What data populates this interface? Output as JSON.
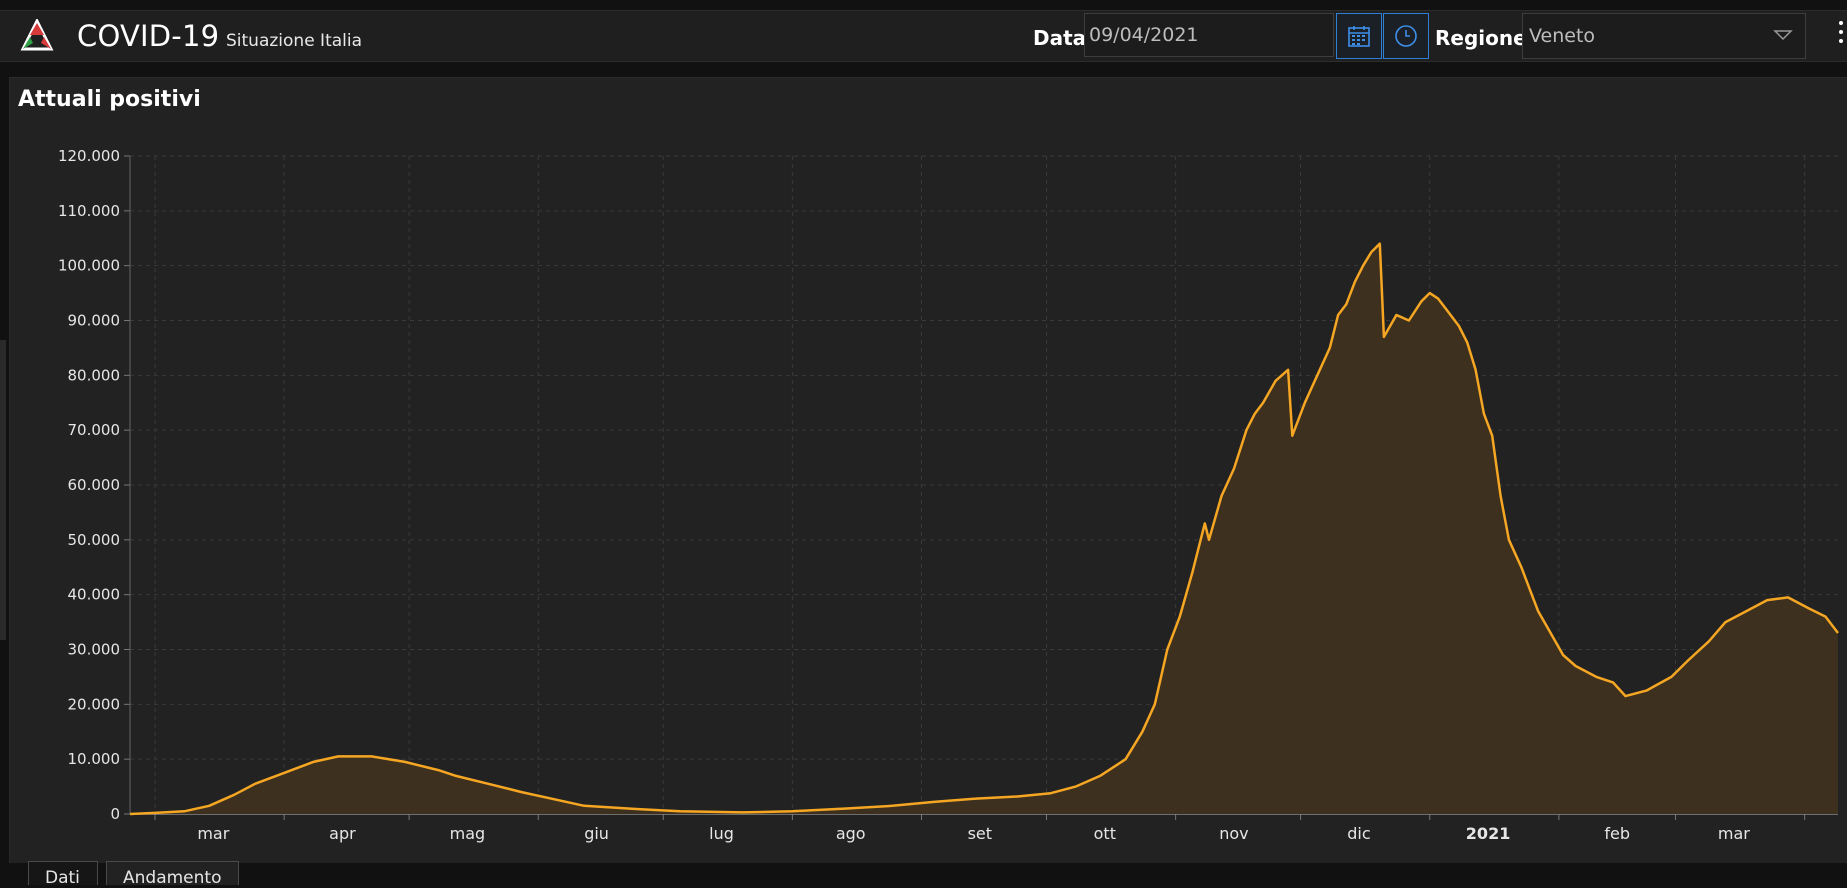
{
  "header": {
    "app_title": "COVID-19",
    "app_subtitle": "Situazione Italia",
    "date_label": "Data",
    "date_value": "09/04/2021",
    "region_label": "Regione",
    "region_value": "Veneto",
    "icons": {
      "logo": "protezione-civile-logo",
      "calendar": "calendar-icon",
      "clock": "clock-icon",
      "dropdown": "chevron-down-icon",
      "menu": "vertical-dots-icon"
    },
    "accent_color": "#2f7fd6"
  },
  "panel": {
    "title": "Attuali positivi"
  },
  "tabs": [
    {
      "label": "Dati"
    },
    {
      "label": "Andamento"
    }
  ],
  "chart_data": {
    "type": "area",
    "title": "Attuali positivi",
    "xlabel": "",
    "ylabel": "",
    "ylim": [
      0,
      120000
    ],
    "xlim": [
      "2020-02-24",
      "2021-04-09"
    ],
    "yticks": [
      0,
      10000,
      20000,
      30000,
      40000,
      50000,
      60000,
      70000,
      80000,
      90000,
      100000,
      110000,
      120000
    ],
    "ytick_labels": [
      "0",
      "10.000",
      "20.000",
      "30.000",
      "40.000",
      "50.000",
      "60.000",
      "70.000",
      "80.000",
      "90.000",
      "100.000",
      "110.000",
      "120.000"
    ],
    "xticks": [
      {
        "date": "2020-03-15",
        "label": "mar",
        "bold": false
      },
      {
        "date": "2020-04-15",
        "label": "apr",
        "bold": false
      },
      {
        "date": "2020-05-15",
        "label": "mag",
        "bold": false
      },
      {
        "date": "2020-06-15",
        "label": "giu",
        "bold": false
      },
      {
        "date": "2020-07-15",
        "label": "lug",
        "bold": false
      },
      {
        "date": "2020-08-15",
        "label": "ago",
        "bold": false
      },
      {
        "date": "2020-09-15",
        "label": "set",
        "bold": false
      },
      {
        "date": "2020-10-15",
        "label": "ott",
        "bold": false
      },
      {
        "date": "2020-11-15",
        "label": "nov",
        "bold": false
      },
      {
        "date": "2020-12-15",
        "label": "dic",
        "bold": false
      },
      {
        "date": "2021-01-15",
        "label": "2021",
        "bold": true
      },
      {
        "date": "2021-02-15",
        "label": "feb",
        "bold": false
      },
      {
        "date": "2021-03-15",
        "label": "mar",
        "bold": false
      }
    ],
    "grid": true,
    "line_color": "#f5a623",
    "fill_color": "#3d301e",
    "series": [
      {
        "name": "",
        "points": [
          [
            "2020-02-24",
            0
          ],
          [
            "2020-03-01",
            200
          ],
          [
            "2020-03-08",
            500
          ],
          [
            "2020-03-14",
            1500
          ],
          [
            "2020-03-20",
            3500
          ],
          [
            "2020-03-25",
            5500
          ],
          [
            "2020-04-01",
            7500
          ],
          [
            "2020-04-08",
            9500
          ],
          [
            "2020-04-14",
            10500
          ],
          [
            "2020-04-22",
            10500
          ],
          [
            "2020-04-30",
            9500
          ],
          [
            "2020-05-08",
            8000
          ],
          [
            "2020-05-12",
            7000
          ],
          [
            "2020-05-20",
            5500
          ],
          [
            "2020-05-28",
            4000
          ],
          [
            "2020-06-06",
            2500
          ],
          [
            "2020-06-12",
            1500
          ],
          [
            "2020-06-25",
            900
          ],
          [
            "2020-07-05",
            500
          ],
          [
            "2020-07-20",
            300
          ],
          [
            "2020-08-01",
            500
          ],
          [
            "2020-08-14",
            1000
          ],
          [
            "2020-08-25",
            1500
          ],
          [
            "2020-09-04",
            2200
          ],
          [
            "2020-09-14",
            2800
          ],
          [
            "2020-09-24",
            3200
          ],
          [
            "2020-10-02",
            3800
          ],
          [
            "2020-10-08",
            5000
          ],
          [
            "2020-10-14",
            7000
          ],
          [
            "2020-10-20",
            10000
          ],
          [
            "2020-10-24",
            15000
          ],
          [
            "2020-10-27",
            20000
          ],
          [
            "2020-10-30",
            30000
          ],
          [
            "2020-11-02",
            36000
          ],
          [
            "2020-11-05",
            44000
          ],
          [
            "2020-11-08",
            53000
          ],
          [
            "2020-11-09",
            50000
          ],
          [
            "2020-11-12",
            58000
          ],
          [
            "2020-11-15",
            63000
          ],
          [
            "2020-11-18",
            70000
          ],
          [
            "2020-11-20",
            73000
          ],
          [
            "2020-11-22",
            75000
          ],
          [
            "2020-11-25",
            79000
          ],
          [
            "2020-11-28",
            81000
          ],
          [
            "2020-11-29",
            69000
          ],
          [
            "2020-12-02",
            75000
          ],
          [
            "2020-12-05",
            80000
          ],
          [
            "2020-12-08",
            85000
          ],
          [
            "2020-12-10",
            91000
          ],
          [
            "2020-12-12",
            93000
          ],
          [
            "2020-12-14",
            97000
          ],
          [
            "2020-12-16",
            100000
          ],
          [
            "2020-12-18",
            102500
          ],
          [
            "2020-12-20",
            104000
          ],
          [
            "2020-12-21",
            87000
          ],
          [
            "2020-12-24",
            91000
          ],
          [
            "2020-12-27",
            90000
          ],
          [
            "2020-12-30",
            93500
          ],
          [
            "2021-01-01",
            95000
          ],
          [
            "2021-01-03",
            94000
          ],
          [
            "2021-01-05",
            92000
          ],
          [
            "2021-01-08",
            89000
          ],
          [
            "2021-01-10",
            86000
          ],
          [
            "2021-01-12",
            81000
          ],
          [
            "2021-01-14",
            73000
          ],
          [
            "2021-01-16",
            69000
          ],
          [
            "2021-01-18",
            58000
          ],
          [
            "2021-01-20",
            50000
          ],
          [
            "2021-01-23",
            45000
          ],
          [
            "2021-01-25",
            41000
          ],
          [
            "2021-01-27",
            37000
          ],
          [
            "2021-01-30",
            33000
          ],
          [
            "2021-02-02",
            29000
          ],
          [
            "2021-02-05",
            27000
          ],
          [
            "2021-02-10",
            25000
          ],
          [
            "2021-02-14",
            24000
          ],
          [
            "2021-02-17",
            21500
          ],
          [
            "2021-02-22",
            22500
          ],
          [
            "2021-02-28",
            25000
          ],
          [
            "2021-03-04",
            28000
          ],
          [
            "2021-03-09",
            31500
          ],
          [
            "2021-03-13",
            35000
          ],
          [
            "2021-03-18",
            37000
          ],
          [
            "2021-03-23",
            39000
          ],
          [
            "2021-03-28",
            39500
          ],
          [
            "2021-04-02",
            37500
          ],
          [
            "2021-04-06",
            36000
          ],
          [
            "2021-04-09",
            33000
          ]
        ]
      }
    ]
  }
}
